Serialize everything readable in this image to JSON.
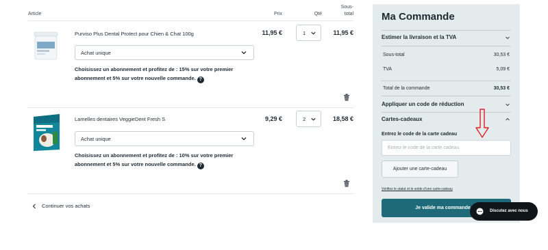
{
  "table": {
    "headers": {
      "article": "Article",
      "price": "Prix",
      "qty": "Qté",
      "subtotal": "Sous-total"
    }
  },
  "items": [
    {
      "name": "Purviso Plus Dental Protect pour Chien & Chat 100g",
      "purchase_option": "Achat unique",
      "promo": "Choisissez un abonnement et profitez de : 15% sur votre premier abonnement et 5% sur votre nouvelle commande.",
      "price": "11,95 €",
      "qty": "1",
      "subtotal": "11,95 €"
    },
    {
      "name": "Lamelles dentaires VeggieDent Fresh S",
      "purchase_option": "Achat unique",
      "promo": "Choisissez un abonnement et profitez de : 10% sur votre premier abonnement et 5% sur votre nouvelle commande.",
      "price": "9,29 €",
      "qty": "2",
      "subtotal": "18,58 €"
    }
  ],
  "continue_label": "Continuer vos achats",
  "order": {
    "title": "Ma Commande",
    "estimate_label": "Estimer la livraison et la TVA",
    "subtotal_label": "Sous-total",
    "subtotal_value": "30,53 €",
    "tax_label": "TVA",
    "tax_value": "5,09 €",
    "total_label": "Total de la commande",
    "total_value": "30,53 €",
    "discount_label": "Appliquer un code de réduction",
    "giftcards_label": "Cartes-cadeaux",
    "giftcard_field_label": "Entrez le code de la carte cadeau",
    "giftcard_placeholder": "Entrez le code de la carte cadeau",
    "add_giftcard_label": "Ajouter une carte-cadeau",
    "check_link": "Vérifiez le statut et le solde d'une carte-cadeau",
    "validate_label": "Je valide ma commande"
  },
  "chat": {
    "label": "Discutez avec nous"
  },
  "colors": {
    "primary": "#1f6a78",
    "panel_bg": "#e3ebec",
    "arrow": "#e02020",
    "chat_bg": "#10151a"
  },
  "icons": [
    "trash-icon",
    "chevron-down-icon",
    "chevron-up-icon",
    "chevron-left-icon",
    "chat-bubble-icon",
    "down-arrow-annotation"
  ]
}
